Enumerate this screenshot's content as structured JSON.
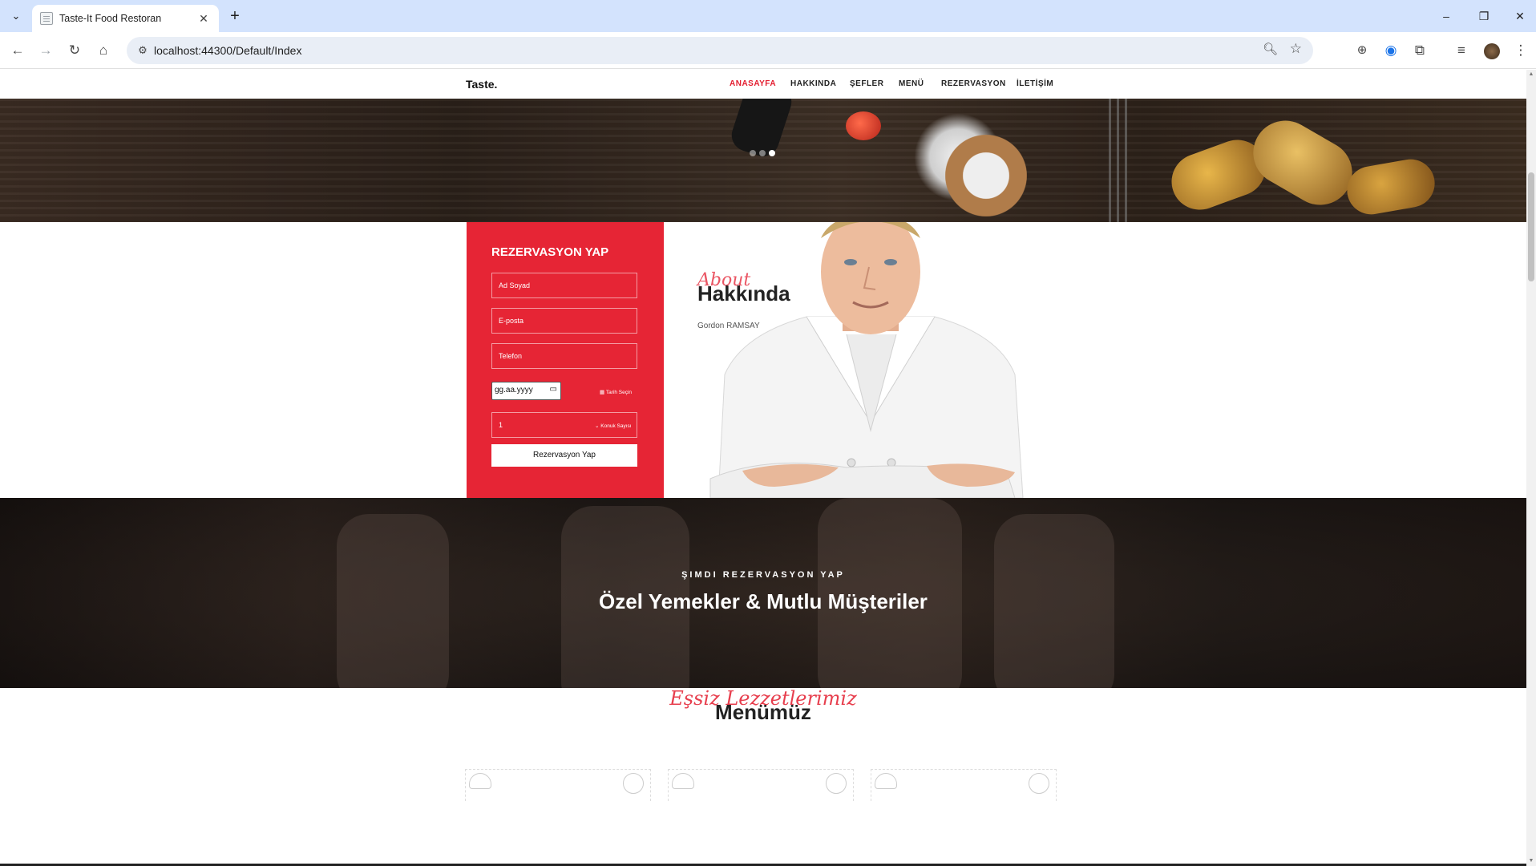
{
  "browser": {
    "tab_title": "Taste-It Food Restoran",
    "url": "localhost:44300/Default/Index",
    "new_tab_symbol": "+",
    "close_symbol": "✕"
  },
  "site": {
    "brand": "Taste.",
    "nav": [
      {
        "label": "ANASAYFA",
        "active": true
      },
      {
        "label": "HAKKINDA",
        "active": false
      },
      {
        "label": "ŞEFLER",
        "active": false
      },
      {
        "label": "MENÜ",
        "active": false
      },
      {
        "label": "REZERVASYON",
        "active": false
      },
      {
        "label": "İLETİŞİM",
        "active": false
      }
    ],
    "hero": {
      "slides": 3,
      "active_slide": 3
    }
  },
  "reservation": {
    "title": "REZERVASYON YAP",
    "name_placeholder": "Ad Soyad",
    "email_placeholder": "E-posta",
    "phone_placeholder": "Telefon",
    "date_value": "gg.aa.yyyy",
    "date_hint": "Tarih Seçin",
    "guests_value": "1",
    "guests_hint": "Konuk Sayısı",
    "submit_label": "Rezervasyon Yap"
  },
  "about": {
    "script": "About",
    "heading": "Hakkında",
    "chef_name": "Gordon RAMSAY"
  },
  "banner": {
    "kicker": "ŞIMDI REZERVASYON YAP",
    "title": "Özel Yemekler & Mutlu Müşteriler"
  },
  "menu": {
    "script": "Eşsiz Lezzetlerimiz",
    "heading": "Menümüz"
  },
  "colors": {
    "accent": "#e31d2f",
    "reservation_bg": "#e62535",
    "chrome_tabbar": "#d3e3fd"
  }
}
